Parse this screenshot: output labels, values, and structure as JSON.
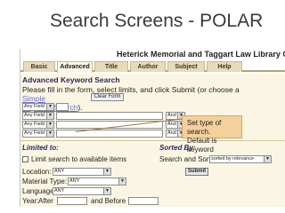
{
  "slide": {
    "title": "Search Screens - POLAR"
  },
  "header": {
    "library_name": "Heterick Memorial and Taggart Law Library Cata"
  },
  "tabs": [
    "Basic",
    "Advanced",
    "Title",
    "Author",
    "Subject",
    "Help"
  ],
  "advanced": {
    "title": "Advanced Keyword Search",
    "instr_line1": "Please fill in the form, select limits, and click Submit (or choose a ",
    "instr_link1": "Simple",
    "instr_link2": "Keyword Search",
    "instr_end": ").",
    "clear_label": "Clear Form"
  },
  "rows": [
    {
      "field": "Any Field",
      "bool": ""
    },
    {
      "field": "Any Field",
      "bool": "And"
    },
    {
      "field": "Any Field",
      "bool": "And"
    },
    {
      "field": "Any Field",
      "bool": "And"
    }
  ],
  "callout": {
    "line1": "Set type of search.",
    "line2": "Default is keyword"
  },
  "limits": {
    "heading": "Limited to:",
    "available_label": "Limit search to available items",
    "location_label": "Location:",
    "location_value": "ANY",
    "material_label": "Material Type:",
    "material_value": "ANY",
    "language_label": "Language:",
    "language_value": "ANY",
    "year_label": "Year:",
    "after_label": "After",
    "before_label": "and Before"
  },
  "sort": {
    "heading": "Sorted By:",
    "label": "Search and Sort:",
    "value": "sorted by relevance",
    "submit_label": "Submit"
  },
  "icons": {
    "dropdown_arrow": "chevron-down-icon"
  },
  "colors": {
    "tab_bg": "#e7dcb9",
    "content_bg": "#fbf6e4",
    "callout_bg": "#f3d09c",
    "link": "#6b6bd6"
  }
}
